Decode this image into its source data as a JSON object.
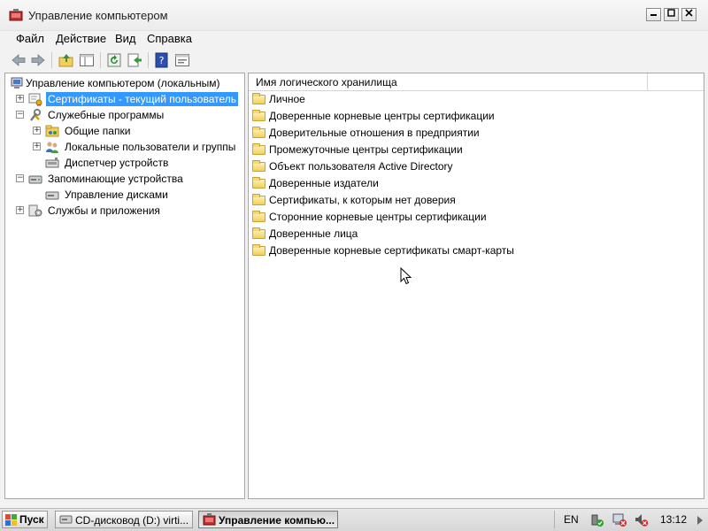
{
  "window": {
    "title": "Управление компьютером"
  },
  "menu": [
    "Файл",
    "Действие",
    "Вид",
    "Справка"
  ],
  "tree": [
    {
      "label": "Управление компьютером (локальным)"
    },
    {
      "label": "Сертификаты - текущий пользователь",
      "selected": true
    },
    {
      "label": "Служебные программы"
    },
    {
      "label": "Общие папки"
    },
    {
      "label": "Локальные пользователи и группы"
    },
    {
      "label": "Диспетчер устройств"
    },
    {
      "label": "Запоминающие устройства"
    },
    {
      "label": "Управление дисками"
    },
    {
      "label": "Службы и приложения"
    }
  ],
  "list": {
    "column_header": "Имя логического хранилища",
    "items": [
      "Личное",
      "Доверенные корневые центры сертификации",
      "Доверительные отношения в предприятии",
      "Промежуточные центры сертификации",
      "Объект пользователя Active Directory",
      "Доверенные издатели",
      "Сертификаты, к которым нет доверия",
      "Сторонние корневые центры сертификации",
      "Доверенные лица",
      "Доверенные корневые сертификаты смарт-карты"
    ]
  },
  "taskbar": {
    "start_label": "Пуск",
    "tasks": [
      "CD-дисковод (D:) virti...",
      "Управление компью..."
    ],
    "language": "EN",
    "clock": "13:12"
  },
  "colors": {
    "selection": "#3399ff",
    "folder": "#f1cf5a"
  }
}
